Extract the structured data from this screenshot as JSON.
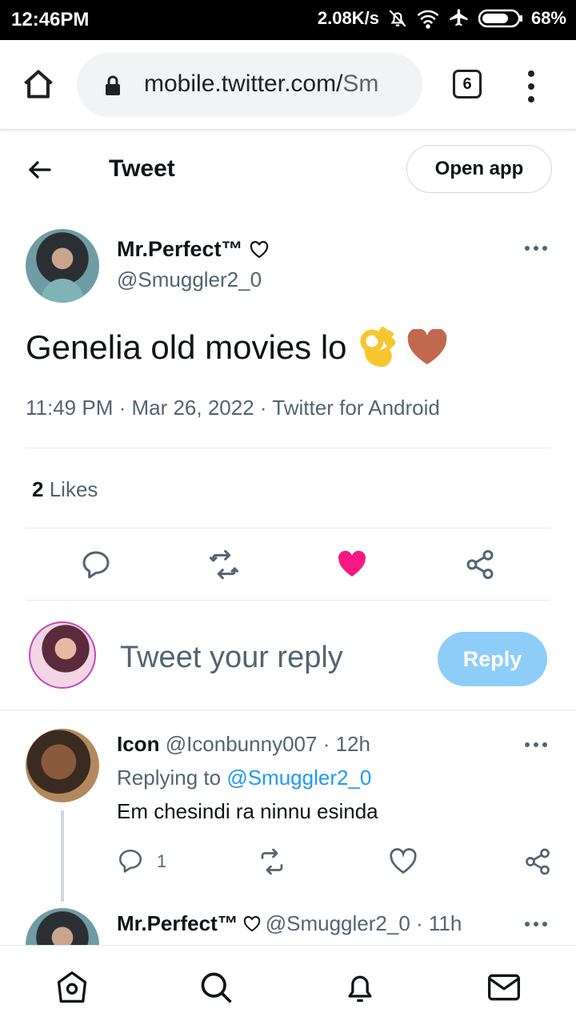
{
  "status_bar": {
    "time": "12:46PM",
    "net_speed": "2.08K/s",
    "battery": "68%",
    "icons": [
      "bell-off-icon",
      "wifi-icon",
      "airplane-icon",
      "battery-icon"
    ]
  },
  "browser": {
    "url_main": "mobile.twitter.com/",
    "url_fade": "Sm",
    "tab_count": "6",
    "icons": [
      "home-icon",
      "lock-icon",
      "menu-icon"
    ]
  },
  "header": {
    "title": "Tweet",
    "open_app": "Open app"
  },
  "tweet": {
    "author_name": "Mr.Perfect™",
    "author_handle": "@Smuggler2_0",
    "text": "Genelia old movies lo",
    "emojis": [
      "ok-hand-icon",
      "brown-heart-icon"
    ],
    "meta": "11:49 PM · Mar 26, 2022 · Twitter for Android",
    "likes_count": "2",
    "likes_label": "Likes",
    "liked": true,
    "colors": {
      "like_pink": "#f91880",
      "brown_heart": "#c1694f"
    }
  },
  "composer": {
    "placeholder": "Tweet your reply",
    "reply_button": "Reply",
    "colors": {
      "reply_button_bg": "#8ecdf8"
    }
  },
  "replies": [
    {
      "name": "Icon",
      "handle": "@Iconbunny007",
      "time": "· 12h",
      "replying_label": "Replying to",
      "replying_to": "@Smuggler2_0",
      "text": "Em chesindi ra ninnu esinda",
      "reply_count": "1"
    },
    {
      "name": "Mr.Perfect™",
      "handle_time": "@Smuggler2_0 · 11h"
    }
  ],
  "bottom_nav": [
    "home-icon",
    "search-icon",
    "notifications-icon",
    "messages-icon"
  ]
}
